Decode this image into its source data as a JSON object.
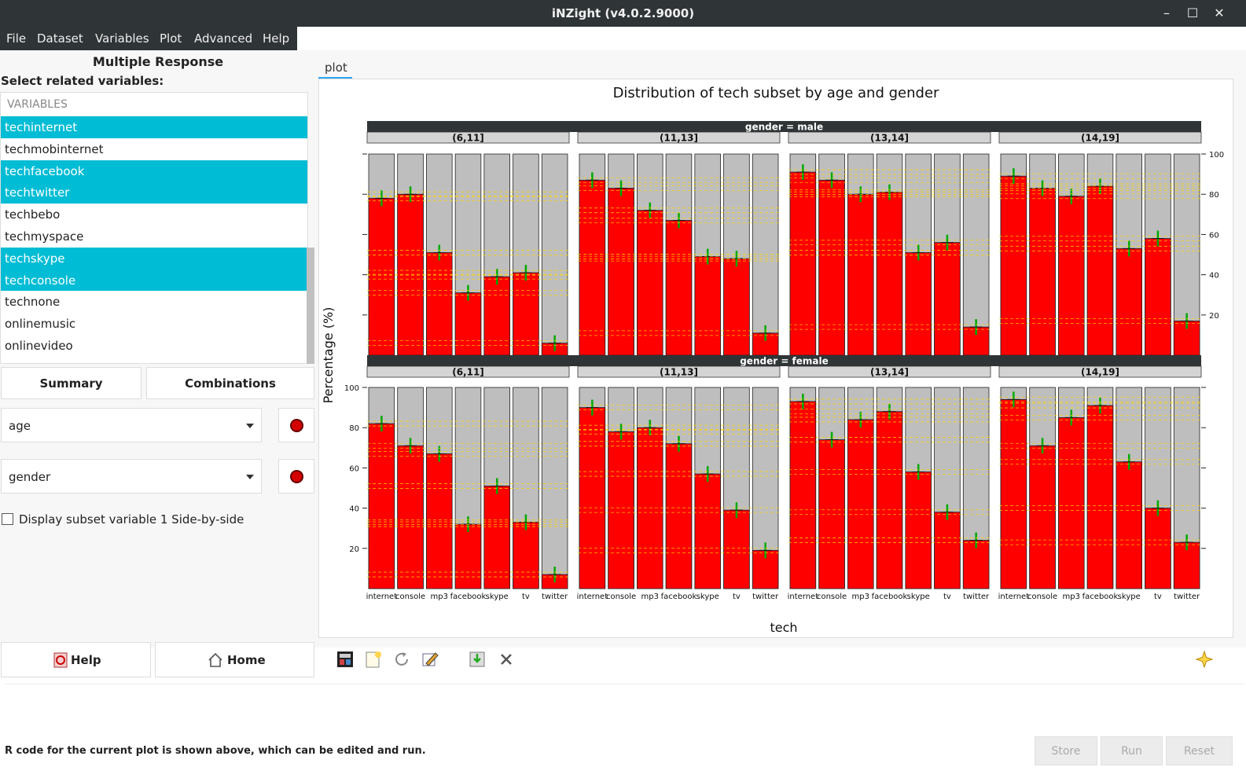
{
  "window": {
    "title": "iNZight (v4.0.2.9000)",
    "minimize": "–",
    "maximize": "☐",
    "close": "✕"
  },
  "menu": [
    "File",
    "Dataset",
    "Variables",
    "Plot",
    "Advanced",
    "Help"
  ],
  "panel": {
    "title": "Multiple Response",
    "select_label": "Select related variables:",
    "list_header": "VARIABLES",
    "variables": [
      {
        "name": "techinternet",
        "selected": true
      },
      {
        "name": "techmobinternet",
        "selected": false
      },
      {
        "name": "techfacebook",
        "selected": true
      },
      {
        "name": "techtwitter",
        "selected": true
      },
      {
        "name": "techbebo",
        "selected": false
      },
      {
        "name": "techmyspace",
        "selected": false
      },
      {
        "name": "techskype",
        "selected": true
      },
      {
        "name": "techconsole",
        "selected": true
      },
      {
        "name": "technone",
        "selected": false
      },
      {
        "name": "onlinemusic",
        "selected": false
      },
      {
        "name": "onlinevideo",
        "selected": false
      }
    ],
    "summary_button": "Summary",
    "combinations_button": "Combinations",
    "subset1": "age",
    "subset2": "gender",
    "side_by_side_label": "Display subset variable 1 Side-by-side",
    "help_button": "Help",
    "home_button": "Home"
  },
  "plot_tab": "plot",
  "status_text": "R code for the current plot is shown above, which can be edited and run.",
  "footer_buttons": {
    "store": "Store",
    "run": "Run",
    "reset": "Reset"
  },
  "toolbar_icons": [
    "new-window-icon",
    "new-plot-icon",
    "refresh-icon",
    "edit-icon",
    "export-icon",
    "delete-icon",
    "favourite-icon"
  ],
  "colors": {
    "bar_fill": "#ff0000",
    "bar_background": "#bebebe",
    "ci_line": "#00aa00",
    "gridline": "#ffd700",
    "strip": "#2f3436"
  },
  "chart_data": {
    "type": "bar",
    "title": "Distribution of tech subset by age and gender",
    "xlabel": "tech",
    "ylabel": "Percentage (%)",
    "ylim": [
      0,
      100
    ],
    "yticks": [
      20,
      40,
      60,
      80,
      100
    ],
    "categories": [
      "internet",
      "console",
      "mp3",
      "facebook",
      "skype",
      "tv",
      "twitter"
    ],
    "panels": [
      {
        "strip": "gender = male",
        "facets": [
          {
            "label": "(6,11]",
            "values": [
              78,
              80,
              51,
              31,
              39,
              41,
              6
            ]
          },
          {
            "label": "(11,13]",
            "values": [
              87,
              83,
              72,
              67,
              49,
              48,
              11
            ]
          },
          {
            "label": "(13,14]",
            "values": [
              91,
              87,
              80,
              81,
              51,
              56,
              14
            ]
          },
          {
            "label": "(14,19]",
            "values": [
              89,
              83,
              79,
              84,
              53,
              58,
              17
            ]
          }
        ]
      },
      {
        "strip": "gender = female",
        "facets": [
          {
            "label": "(6,11]",
            "values": [
              82,
              71,
              67,
              32,
              51,
              33,
              7
            ]
          },
          {
            "label": "(11,13]",
            "values": [
              90,
              78,
              80,
              72,
              57,
              39,
              19
            ]
          },
          {
            "label": "(13,14]",
            "values": [
              93,
              74,
              84,
              88,
              58,
              38,
              24
            ]
          },
          {
            "label": "(14,19]",
            "values": [
              94,
              71,
              85,
              91,
              63,
              40,
              23
            ]
          }
        ]
      }
    ]
  }
}
